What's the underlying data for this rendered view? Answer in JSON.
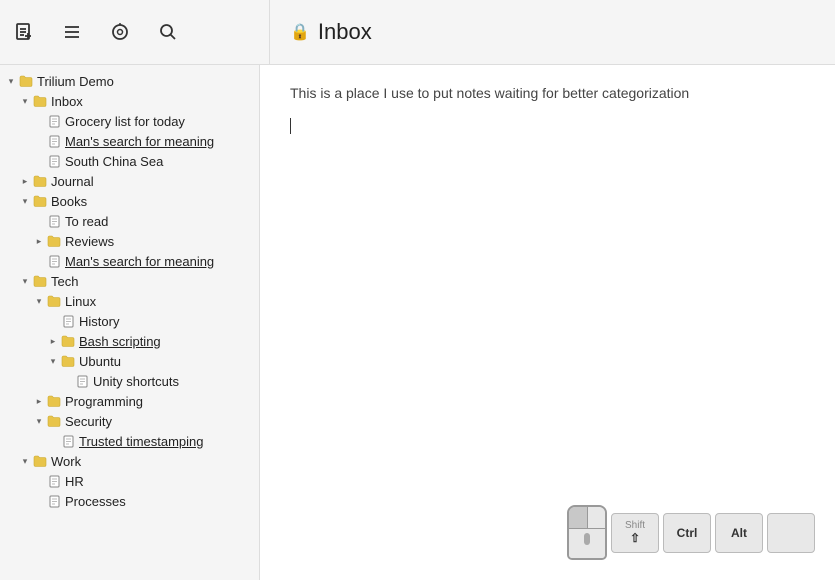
{
  "toolbar": {
    "new_note_label": "+",
    "note_list_label": "≡",
    "history_label": "⊕",
    "search_label": "🔍",
    "lock_icon": "🔒",
    "page_title": "Inbox"
  },
  "content": {
    "description": "This is a place I use to put notes waiting for better categorization"
  },
  "tree": {
    "root": "Trilium Demo",
    "items": [
      {
        "id": "trilium-demo",
        "label": "Trilium Demo",
        "type": "folder",
        "level": 0,
        "expanded": true,
        "toggle": "▾"
      },
      {
        "id": "inbox",
        "label": "Inbox",
        "type": "folder",
        "level": 1,
        "expanded": true,
        "toggle": "▾"
      },
      {
        "id": "grocery",
        "label": "Grocery list for today",
        "type": "note",
        "level": 2,
        "toggle": ""
      },
      {
        "id": "mans-search-inbox",
        "label": "Man's search for meaning",
        "type": "note",
        "level": 2,
        "toggle": "",
        "underline": true
      },
      {
        "id": "south-china",
        "label": "South China Sea",
        "type": "note",
        "level": 2,
        "toggle": ""
      },
      {
        "id": "journal",
        "label": "Journal",
        "type": "folder",
        "level": 1,
        "expanded": false,
        "toggle": "▸"
      },
      {
        "id": "books",
        "label": "Books",
        "type": "folder",
        "level": 1,
        "expanded": true,
        "toggle": "▾"
      },
      {
        "id": "to-read",
        "label": "To read",
        "type": "note",
        "level": 2,
        "toggle": ""
      },
      {
        "id": "reviews",
        "label": "Reviews",
        "type": "folder",
        "level": 2,
        "expanded": false,
        "toggle": "▸"
      },
      {
        "id": "mans-search-books",
        "label": "Man's search for meaning",
        "type": "note",
        "level": 2,
        "toggle": "",
        "underline": true
      },
      {
        "id": "tech",
        "label": "Tech",
        "type": "folder",
        "level": 1,
        "expanded": true,
        "toggle": "▾"
      },
      {
        "id": "linux",
        "label": "Linux",
        "type": "folder",
        "level": 2,
        "expanded": true,
        "toggle": "▾"
      },
      {
        "id": "history",
        "label": "History",
        "type": "note",
        "level": 3,
        "toggle": ""
      },
      {
        "id": "bash",
        "label": "Bash scripting",
        "type": "folder",
        "level": 3,
        "expanded": false,
        "toggle": "▸",
        "underline": true
      },
      {
        "id": "ubuntu",
        "label": "Ubuntu",
        "type": "folder",
        "level": 3,
        "expanded": true,
        "toggle": "▾"
      },
      {
        "id": "unity",
        "label": "Unity shortcuts",
        "type": "note",
        "level": 4,
        "toggle": ""
      },
      {
        "id": "programming",
        "label": "Programming",
        "type": "folder",
        "level": 2,
        "expanded": false,
        "toggle": "▸"
      },
      {
        "id": "security",
        "label": "Security",
        "type": "folder",
        "level": 2,
        "expanded": true,
        "toggle": "▾"
      },
      {
        "id": "trusted",
        "label": "Trusted timestamping",
        "type": "note",
        "level": 3,
        "toggle": "",
        "underline": true
      },
      {
        "id": "work",
        "label": "Work",
        "type": "folder",
        "level": 1,
        "expanded": true,
        "toggle": "▾"
      },
      {
        "id": "hr",
        "label": "HR",
        "type": "note",
        "level": 2,
        "toggle": ""
      },
      {
        "id": "processes",
        "label": "Processes",
        "type": "note",
        "level": 2,
        "toggle": ""
      }
    ]
  },
  "keyboard": {
    "shift_top": "Shift",
    "shift_bottom": "⇧",
    "ctrl": "Ctrl",
    "alt": "Alt",
    "empty": ""
  }
}
